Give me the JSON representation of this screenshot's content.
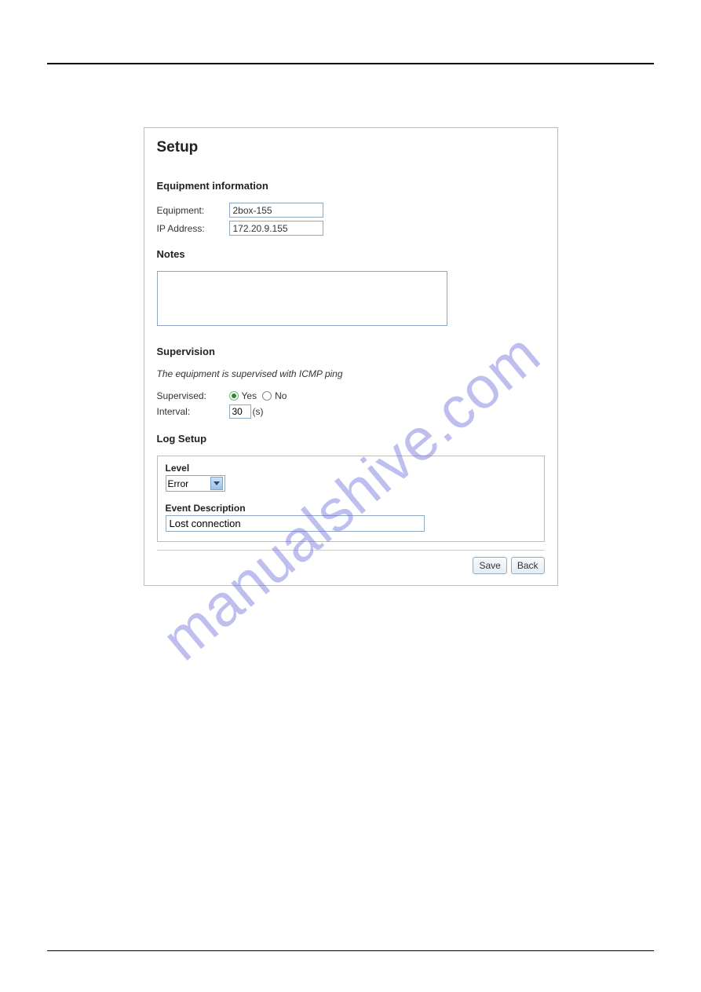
{
  "watermark": "manualshive.com",
  "panel": {
    "title": "Setup",
    "equipment_info": {
      "heading": "Equipment information",
      "equipment_label": "Equipment:",
      "equipment_value": "2box-155",
      "ip_label": "IP Address:",
      "ip_value": "172.20.9.155"
    },
    "notes": {
      "heading": "Notes",
      "value": ""
    },
    "supervision": {
      "heading": "Supervision",
      "message": "The equipment is supervised with ICMP ping",
      "supervised_label": "Supervised:",
      "yes_label": "Yes",
      "no_label": "No",
      "supervised_value": "Yes",
      "interval_label": "Interval:",
      "interval_value": "30",
      "interval_unit": "(s)"
    },
    "log": {
      "heading": "Log Setup",
      "level_label": "Level",
      "level_value": "Error",
      "event_label": "Event Description",
      "event_value": "Lost connection"
    },
    "buttons": {
      "save": "Save",
      "back": "Back"
    }
  }
}
